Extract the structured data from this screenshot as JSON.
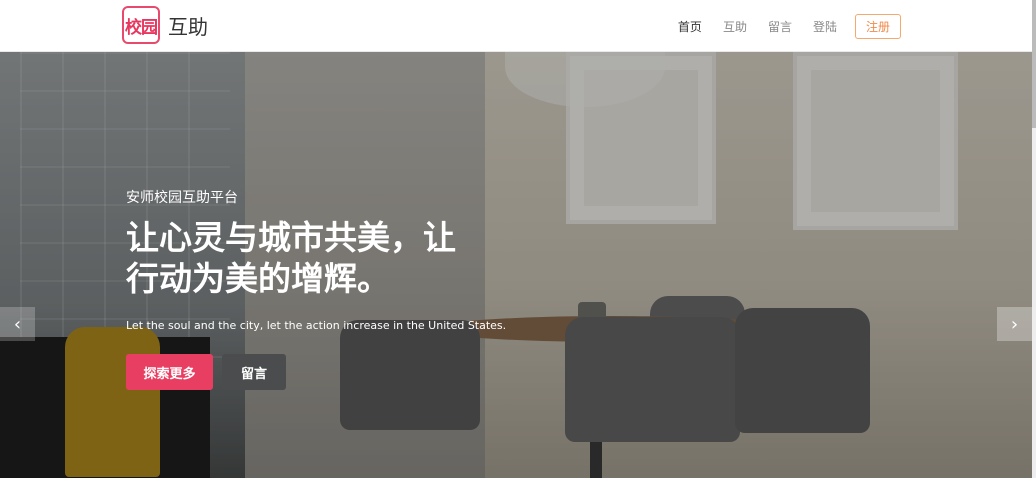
{
  "logo": {
    "mark": "校园",
    "text": "互助"
  },
  "nav": {
    "items": [
      {
        "label": "首页",
        "active": true
      },
      {
        "label": "互助",
        "active": false
      },
      {
        "label": "留言",
        "active": false
      },
      {
        "label": "登陆",
        "active": false
      }
    ],
    "register": "注册"
  },
  "hero": {
    "subtitle": "安师校园互助平台",
    "headline": "让心灵与城市共美，让行动为美的增辉。",
    "description": "Let the soul and the city, let the action increase in the United States.",
    "primary_button": "探索更多",
    "secondary_button": "留言"
  },
  "carousel": {
    "prev_icon": "chevron-left-icon",
    "next_icon": "chevron-right-icon"
  },
  "colors": {
    "accent": "#e83e62",
    "register_border": "#f4a96f"
  }
}
